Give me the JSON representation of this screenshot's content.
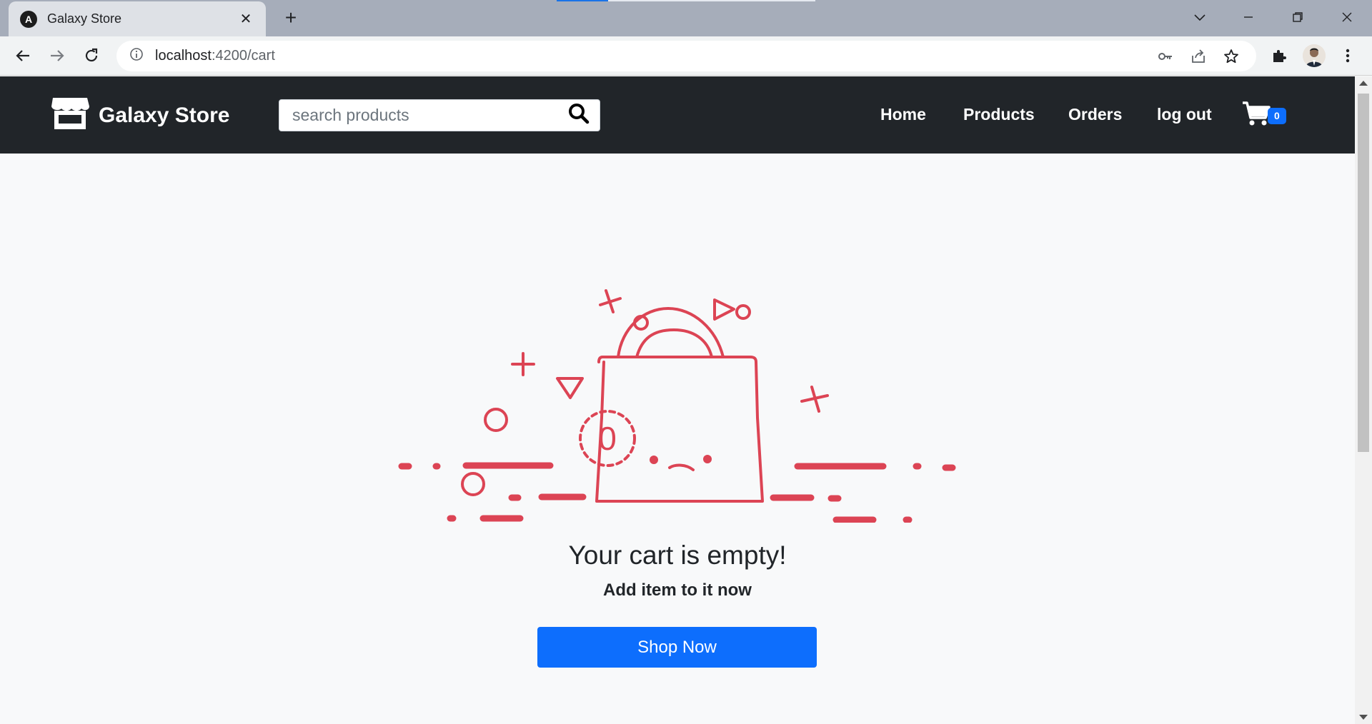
{
  "browser": {
    "tab_title": "Galaxy Store",
    "tab_favicon_letter": "A",
    "url_host": "localhost",
    "url_path": ":4200/cart",
    "icons": [
      "angular-favicon",
      "close-icon",
      "plus-icon",
      "chevron-down-icon",
      "minimize-icon",
      "restore-icon",
      "window-close-icon",
      "back-icon",
      "forward-icon",
      "reload-icon",
      "info-icon",
      "key-icon",
      "share-icon",
      "star-icon",
      "puzzle-icon",
      "avatar",
      "kebab-menu-icon"
    ]
  },
  "navbar": {
    "brand": "Galaxy Store",
    "search_placeholder": "search products",
    "links": [
      "Home",
      "Products",
      "Orders",
      "log out"
    ],
    "cart_count": "0"
  },
  "main": {
    "badge_number": "0",
    "title": "Your cart is empty!",
    "subtitle": "Add item to it now",
    "cta": "Shop Now"
  },
  "colors": {
    "navbar_bg": "#212529",
    "accent_blue": "#0d6efd",
    "illustration_red": "#dc4454",
    "page_bg": "#f8f9fa"
  }
}
